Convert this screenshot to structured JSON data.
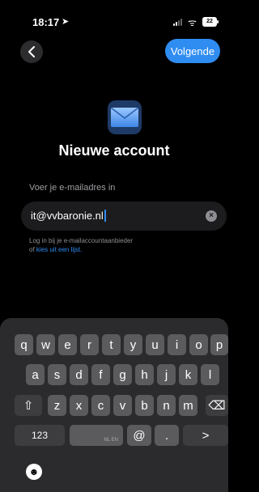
{
  "status_bar": {
    "time": "18:17",
    "location_glyph": "➤",
    "wifi_glyph": "ᯤ",
    "battery": "22"
  },
  "nav": {
    "back_glyph": "<",
    "next_label": "Volgende"
  },
  "title": "Nieuwe account",
  "email": {
    "label": "Voer je e-mailadres in",
    "value": "it@vvbaronie.nl",
    "clear_glyph": "×"
  },
  "hint": {
    "line1": "Log in bij je e-mailaccountaanbieder",
    "line2_prefix": "of ",
    "line2_link": "kies uit een lijst."
  },
  "keyboard": {
    "row1": [
      "q",
      "w",
      "e",
      "r",
      "t",
      "y",
      "u",
      "i",
      "o",
      "p"
    ],
    "row2": [
      "a",
      "s",
      "d",
      "f",
      "g",
      "h",
      "j",
      "k",
      "l"
    ],
    "row3": [
      "z",
      "x",
      "c",
      "v",
      "b",
      "n",
      "m"
    ],
    "shift_glyph": "⇧",
    "delete_glyph": "⌫",
    "numbers_label": "123",
    "space_label": "NL EN",
    "at_label": "@",
    "dot_label": ".",
    "return_glyph": ">",
    "emoji_glyph": "☻"
  },
  "colors": {
    "accent": "#2f8cf0",
    "background": "#000000",
    "key": "#5b5b5e",
    "key_dark": "#3d3d40"
  }
}
